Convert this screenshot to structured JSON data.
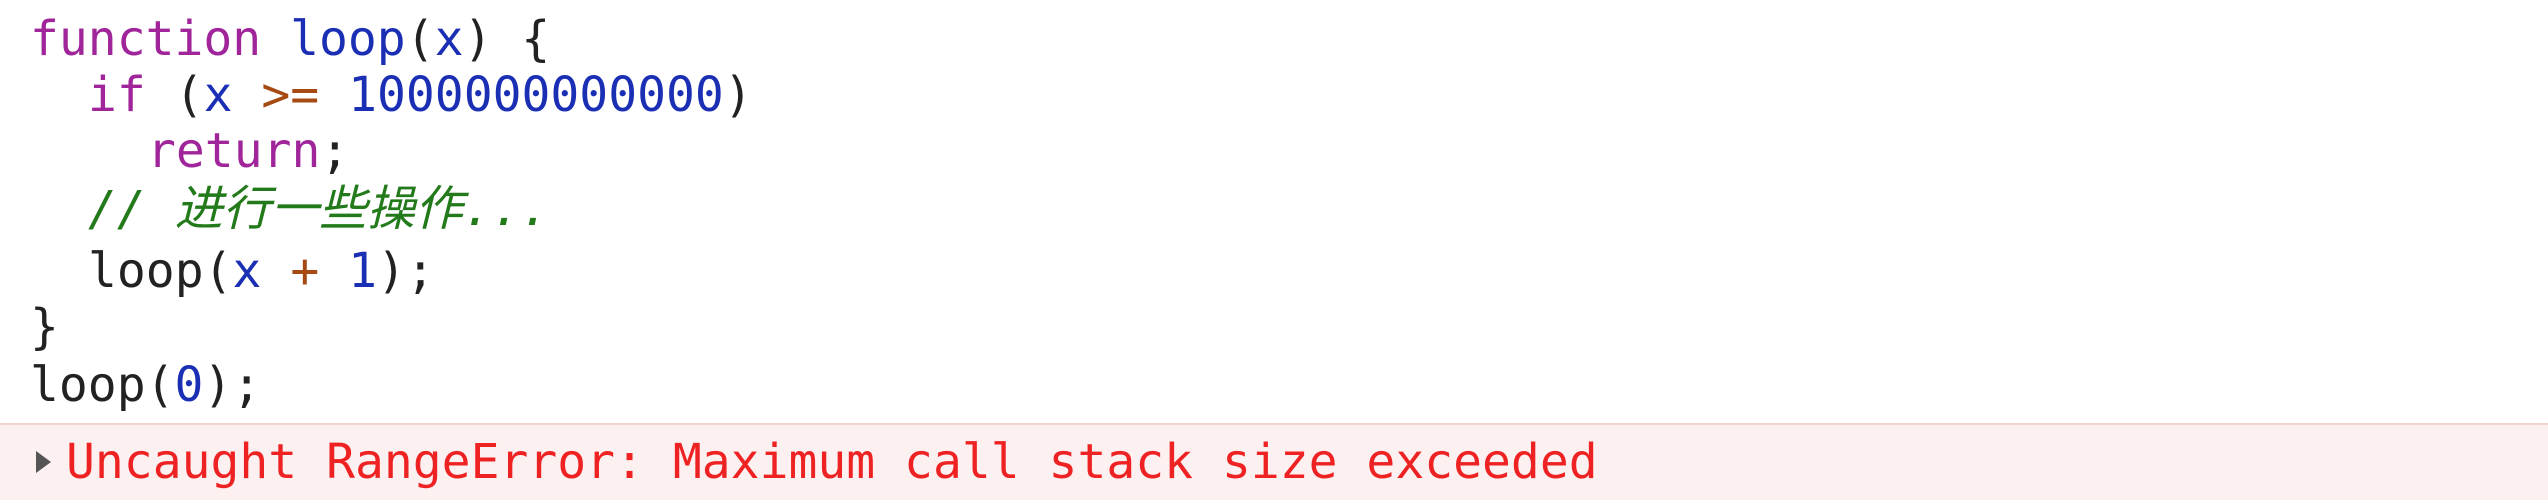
{
  "code": {
    "line1": {
      "keyword": "function",
      "name": "loop",
      "open_paren": "(",
      "param": "x",
      "close": ") {"
    },
    "line2": {
      "keyword": "if",
      "open": " (",
      "var": "x",
      "operator": ">=",
      "number": "1000000000000",
      "close": ")"
    },
    "line3": {
      "keyword": "return",
      "punct": ";"
    },
    "line4": {
      "comment": "// 进行一些操作..."
    },
    "line5": {
      "call": "loop(",
      "var": "x",
      "operator": "+",
      "number": "1",
      "close": ");"
    },
    "line6": {
      "text": "}"
    },
    "line7": {
      "call": "loop(",
      "number": "0",
      "close": ");"
    }
  },
  "error": {
    "message": "Uncaught RangeError: Maximum call stack size exceeded"
  },
  "colors": {
    "keyword": "#a0249a",
    "identifier": "#1b2fb5",
    "operator": "#a64a13",
    "comment": "#237a1b",
    "error_text": "#ee2222",
    "error_background": "#fdf0f0"
  }
}
